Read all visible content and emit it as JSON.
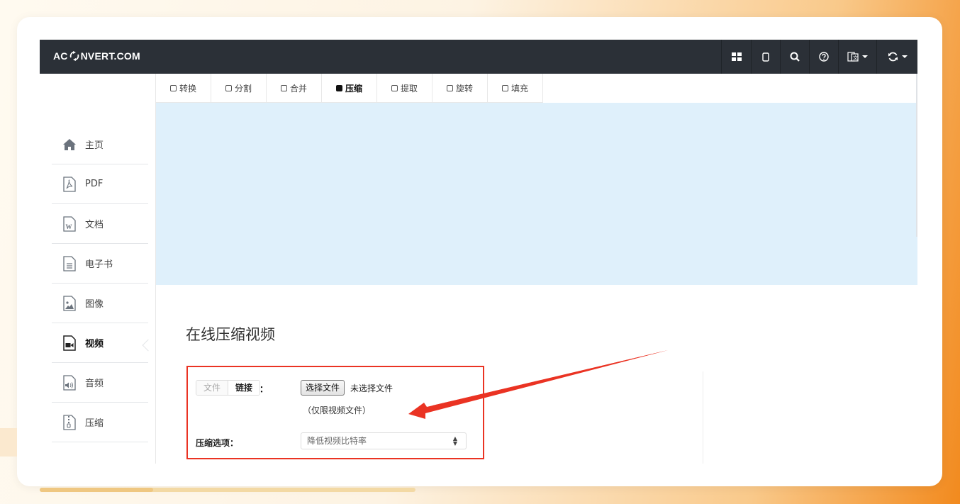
{
  "brand": {
    "logo_prefix": "AC",
    "logo_suffix": "NVERT.COM"
  },
  "topbar": {
    "icons": [
      "grid-icon",
      "tablet-icon",
      "search-icon",
      "help-icon",
      "language-icon",
      "refresh-icon"
    ]
  },
  "sidebar": {
    "items": [
      {
        "label": "主页",
        "icon": "home-icon"
      },
      {
        "label": "PDF",
        "icon": "pdf-icon"
      },
      {
        "label": "文档",
        "icon": "word-doc-icon"
      },
      {
        "label": "电子书",
        "icon": "ebook-icon"
      },
      {
        "label": "图像",
        "icon": "image-icon"
      },
      {
        "label": "视频",
        "icon": "video-icon",
        "active": true
      },
      {
        "label": "音频",
        "icon": "audio-icon"
      },
      {
        "label": "压缩",
        "icon": "archive-icon"
      }
    ]
  },
  "tabs": [
    {
      "label": "转换"
    },
    {
      "label": "分割"
    },
    {
      "label": "合并"
    },
    {
      "label": "压缩",
      "active": true
    },
    {
      "label": "提取"
    },
    {
      "label": "旋转"
    },
    {
      "label": "填充"
    }
  ],
  "page": {
    "title": "在线压缩视频"
  },
  "form": {
    "source_file": "文件",
    "source_link": "链接",
    "colon": "：",
    "choose_file": "选择文件",
    "no_file": "未选择文件",
    "hint": "（仅限视频文件）",
    "option_label": "压缩选项：",
    "option_value": "降低视频比特率"
  },
  "colors": {
    "topbar": "#2b3037",
    "adbox": "#dff0fb",
    "highlight": "#ea3323"
  }
}
